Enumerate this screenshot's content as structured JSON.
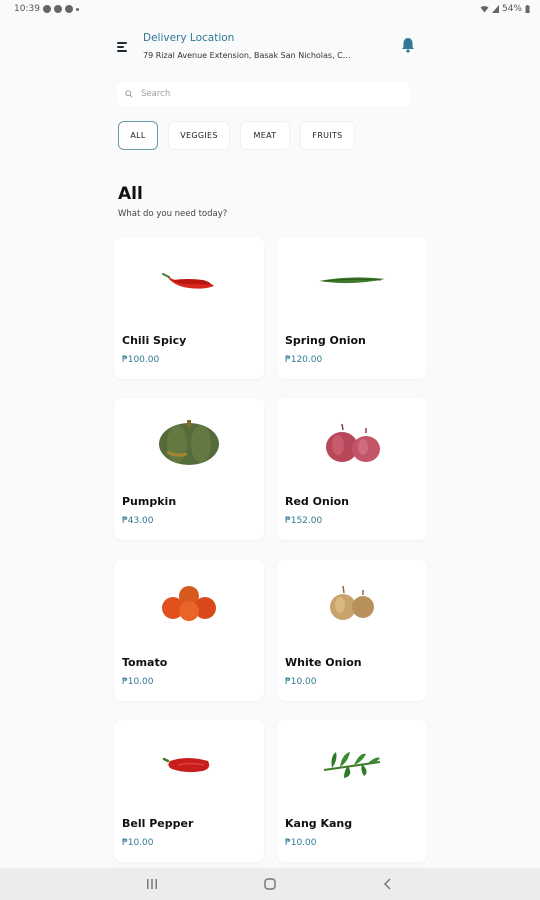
{
  "status_bar": {
    "time": "10:39",
    "battery": "54%"
  },
  "header": {
    "location_title": "Delivery Location",
    "location_address": "79 Rizal Avenue Extension, Basak San Nicholas, C..."
  },
  "search": {
    "placeholder": "Search"
  },
  "tabs": [
    {
      "label": "ALL",
      "active": true
    },
    {
      "label": "VEGGIES",
      "active": false
    },
    {
      "label": "MEAT",
      "active": false
    },
    {
      "label": "FRUITS",
      "active": false
    }
  ],
  "section": {
    "title": "All",
    "subtitle": "What do you need today?"
  },
  "products": [
    {
      "name": "Chili Spicy",
      "price": "₱100.00",
      "icon": "chili-icon"
    },
    {
      "name": "Spring Onion",
      "price": "₱120.00",
      "icon": "spring-onion-icon"
    },
    {
      "name": "Pumpkin",
      "price": "₱43.00",
      "icon": "pumpkin-icon"
    },
    {
      "name": "Red Onion",
      "price": "₱152.00",
      "icon": "red-onion-icon"
    },
    {
      "name": "Tomato",
      "price": "₱10.00",
      "icon": "tomato-icon"
    },
    {
      "name": "White Onion",
      "price": "₱10.00",
      "icon": "white-onion-icon"
    },
    {
      "name": "Bell Pepper",
      "price": "₱10.00",
      "icon": "bell-pepper-icon"
    },
    {
      "name": "Kang Kang",
      "price": "₱10.00",
      "icon": "kangkong-icon"
    }
  ],
  "colors": {
    "accent": "#2f7894",
    "background": "#f9fafb",
    "card": "#ffffff"
  }
}
